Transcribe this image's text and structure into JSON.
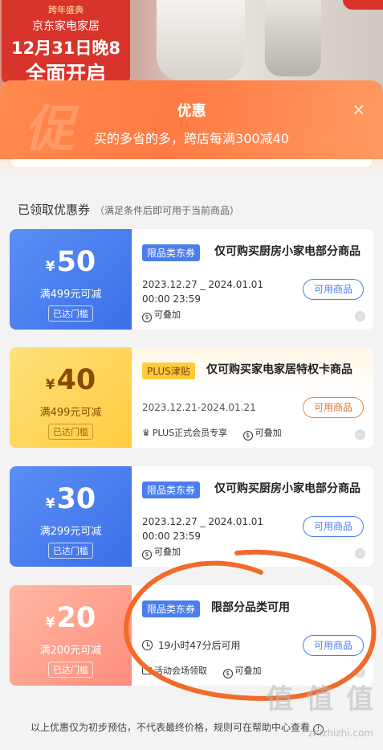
{
  "banner": {
    "small": "跨年盛典",
    "brand": "京东家电家居",
    "date": "12月31日晚8",
    "open": "全面开启"
  },
  "sheet": {
    "title": "优惠",
    "subtitle": "买的多省的多，跨店每满300减40",
    "watermark_char": "促",
    "close": "×"
  },
  "section": {
    "title": "已领取优惠券",
    "note": "（满足条件后即可用于当前商品）"
  },
  "coupons": [
    {
      "yen": "¥",
      "amount": "50",
      "condition": "满499元可减",
      "reached": "已达门槛",
      "tag": "限品类东券",
      "title": "仅可购买厨房小家电部分商品",
      "date_line1": "2023.12.27 _ 2024.01.01",
      "date_line2": "00:00 23:59",
      "button": "可用商品",
      "stack": "可叠加"
    },
    {
      "yen": "¥",
      "amount": "40",
      "condition": "满499元可减",
      "reached": "已达门槛",
      "tag": "PLUS津贴",
      "title": "仅可购买家电家居特权卡商品",
      "date_line1": "2023.12.21-2024.01.21",
      "button": "可用商品",
      "plus_only": "PLUS正式会员专享",
      "stack": "可叠加"
    },
    {
      "yen": "¥",
      "amount": "30",
      "condition": "满299元可减",
      "reached": "已达门槛",
      "tag": "限品类东券",
      "title": "仅可购买厨房小家电部分商品",
      "date_line1": "2023.12.27 _ 2024.01.01",
      "date_line2": "00:00 23:59",
      "button": "可用商品",
      "stack": "可叠加"
    },
    {
      "yen": "¥",
      "amount": "20",
      "condition": "满200元可减",
      "reached": "已达门槛",
      "tag": "限品类东券",
      "title": "限部分品类可用",
      "timer": "19小时47分后可用",
      "button": "可用商品",
      "source": "活动会场领取",
      "stack": "可叠加"
    }
  ],
  "footer": {
    "note": "以上优惠仅为初步预估，不代表最终价格，规则可在帮助中心查看"
  },
  "watermark": {
    "main": "值 值 值",
    "sub": "zhizhizhi.com"
  },
  "colors": {
    "accent_orange": "#ff7a43",
    "coupon_blue": "#3c6fe6",
    "coupon_gold": "#ffcc3f",
    "coupon_pink": "#ff8d7c",
    "annotation_ink": "#f26a2a"
  }
}
